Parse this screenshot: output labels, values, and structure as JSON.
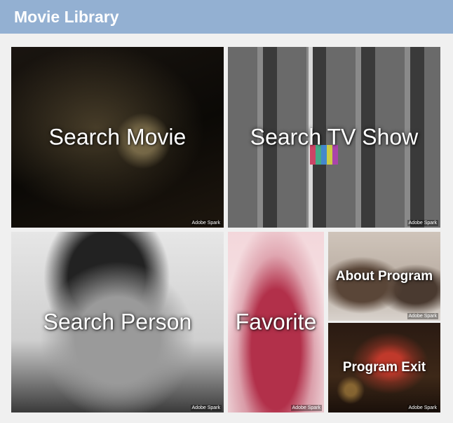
{
  "app": {
    "title": "Movie Library"
  },
  "tiles": {
    "search_movie": {
      "label": "Search Movie",
      "badge": "Adobe Spark"
    },
    "search_tv": {
      "label": "Search TV Show",
      "badge": "Adobe Spark"
    },
    "search_person": {
      "label": "Search Person",
      "badge": "Adobe Spark"
    },
    "favorite": {
      "label": "Favorite",
      "badge": "Adobe Spark"
    },
    "about": {
      "label": "About Program",
      "badge": "Adobe Spark"
    },
    "exit": {
      "label": "Program Exit",
      "badge": "Adobe Spark"
    }
  },
  "colors": {
    "titlebar": "#93b0d2",
    "background": "#f0f0f0",
    "text": "#ffffff"
  }
}
